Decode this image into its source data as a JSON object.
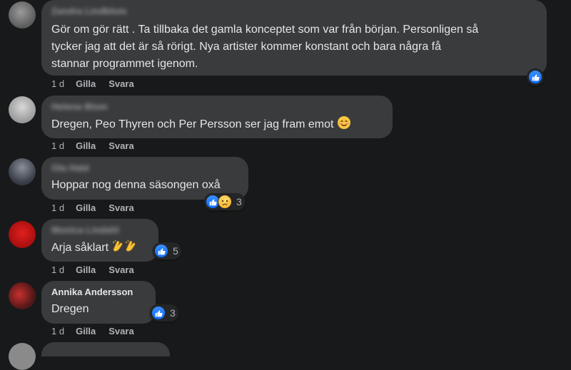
{
  "comments": [
    {
      "author": "Zandra Lindblom",
      "text": "Gör om gör rätt . Ta tillbaka det gamla konceptet som var från början. Personligen så tycker jag att det är så rörigt. Nya artister kommer konstant och bara några få stannar programmet igenom.",
      "line1": "Gör om gör rätt . Ta tillbaka det gamla konceptet som var från början. Personligen så",
      "line2": "tycker jag att det är så rörigt. Nya artister kommer konstant och bara några få",
      "line3": "stannar programmet igenom.",
      "time": "1 d",
      "like": "Gilla",
      "reply": "Svara",
      "reactions": {
        "types": [
          "like-icon"
        ],
        "count": ""
      }
    },
    {
      "author": "Helena Blom",
      "text": "Dregen, Peo Thyren och Per Persson ser jag fram emot",
      "time": "1 d",
      "like": "Gilla",
      "reply": "Svara",
      "emoji": "smiling-face-icon"
    },
    {
      "author": "Ola Hald",
      "text": "Hoppar nog denna säsongen oxå",
      "time": "1 d",
      "like": "Gilla",
      "reply": "Svara",
      "reactions": {
        "types": [
          "like-icon",
          "sad-icon"
        ],
        "count": "3"
      }
    },
    {
      "author": "Monica Lindahl",
      "text": "Arja såklart",
      "time": "1 d",
      "like": "Gilla",
      "reply": "Svara",
      "emoji": "clapping-hands-icon",
      "reactions": {
        "types": [
          "like-icon"
        ],
        "count": "5"
      }
    },
    {
      "author": "Annika Andersson",
      "text": "Dregen",
      "time": "1 d",
      "like": "Gilla",
      "reply": "Svara",
      "reactions": {
        "types": [
          "like-icon"
        ],
        "count": "3"
      }
    }
  ],
  "colors": {
    "background": "#18191a",
    "bubble": "#3a3b3c",
    "text": "#e4e6eb",
    "secondary": "#b0b3b8",
    "like_blue": "#0a6cff"
  }
}
